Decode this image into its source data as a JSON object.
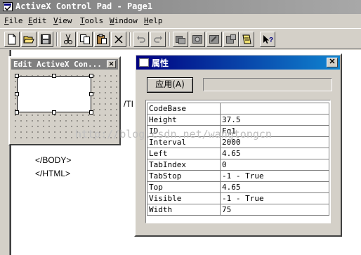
{
  "window": {
    "title": "ActiveX Control Pad - Page1"
  },
  "menu": [
    {
      "label": "File",
      "hotkey": "F",
      "rest": "ile"
    },
    {
      "label": "Edit",
      "hotkey": "E",
      "rest": "dit"
    },
    {
      "label": "View",
      "hotkey": "V",
      "rest": "iew"
    },
    {
      "label": "Tools",
      "hotkey": "T",
      "rest": "ools"
    },
    {
      "label": "Window",
      "hotkey": "W",
      "rest": "indow"
    },
    {
      "label": "Help",
      "hotkey": "H",
      "rest": "elp"
    }
  ],
  "toolbar": {
    "icons": [
      "new-file-icon",
      "open-folder-icon",
      "save-icon",
      "cut-icon",
      "copy-icon",
      "paste-icon",
      "delete-icon",
      "undo-icon",
      "redo-icon",
      "insert-control-icon",
      "insert-layout-icon",
      "edit-control-icon",
      "edit-layout-icon",
      "script-wizard-icon",
      "help-pointer-icon"
    ]
  },
  "editor": {
    "lines": [
      "</BODY>",
      "</HTML>"
    ],
    "partial_tag": "/TI"
  },
  "edit_control_window": {
    "title": "Edit ActiveX Con..."
  },
  "properties_window": {
    "title": "属性",
    "apply_label": "应用(A)",
    "value_input": "",
    "properties": [
      {
        "name": "CodeBase",
        "value": ""
      },
      {
        "name": "Height",
        "value": "37.5"
      },
      {
        "name": "ID",
        "value": "Fq1"
      },
      {
        "name": "Interval",
        "value": "2000"
      },
      {
        "name": "Left",
        "value": "4.65"
      },
      {
        "name": "TabIndex",
        "value": "0"
      },
      {
        "name": "TabStop",
        "value": "-1 - True"
      },
      {
        "name": "Top",
        "value": "4.65"
      },
      {
        "name": "Visible",
        "value": "-1 - True"
      },
      {
        "name": "Width",
        "value": "75"
      }
    ]
  },
  "watermark": "http://blog.csdn.net/wangtongcn"
}
